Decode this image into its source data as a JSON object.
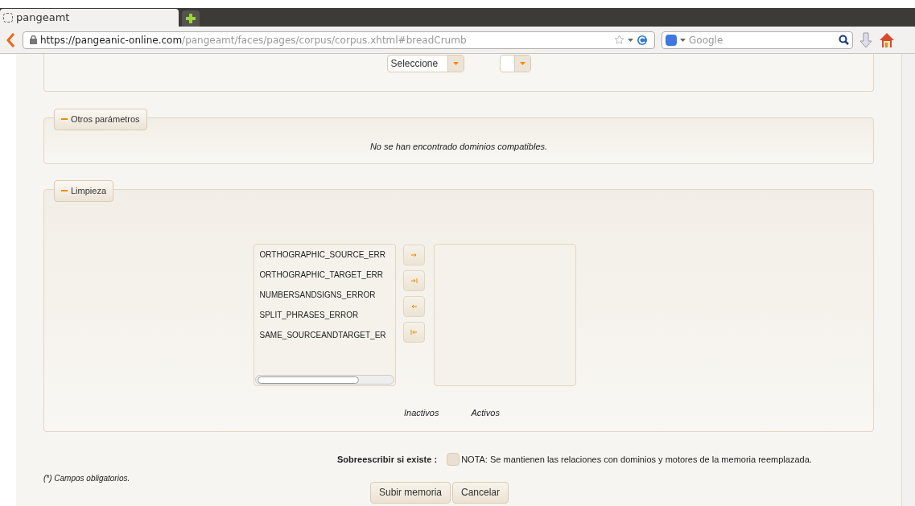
{
  "browser": {
    "tab_title": "pangeamt",
    "url_host": "https://pangeanic-online.com",
    "url_path": "/pangeamt/faces/pages/corpus/corpus.xhtml#breadCrumb",
    "search_placeholder": "Google"
  },
  "top_panel": {
    "select": {
      "value": "Seleccione"
    }
  },
  "otros": {
    "legend": "Otros parámetros",
    "expanded": true,
    "message": "No se han encontrado dominios compatibles."
  },
  "limpieza": {
    "legend": "Limpieza",
    "expanded": true,
    "inactive_items": [
      {
        "label": "ORTHOGRAPHIC_SOURCE_ERR"
      },
      {
        "label": "ORTHOGRAPHIC_TARGET_ERR"
      },
      {
        "label": "NUMBERSANDSIGNS_ERROR"
      },
      {
        "label": "SPLIT_PHRASES_ERROR"
      },
      {
        "label": "SAME_SOURCEANDTARGET_ER"
      }
    ],
    "inactive_caption": "Inactivos",
    "active_caption": "Activos"
  },
  "overwrite": {
    "label": "Sobreescribir si existe :",
    "checked": false,
    "note": "NOTA: Se mantienen las relaciones con dominios y motores de la memoria reemplazada."
  },
  "required_note": "(*) Campos obligatorios.",
  "buttons": [
    "Subir memoria",
    "Cancelar"
  ]
}
